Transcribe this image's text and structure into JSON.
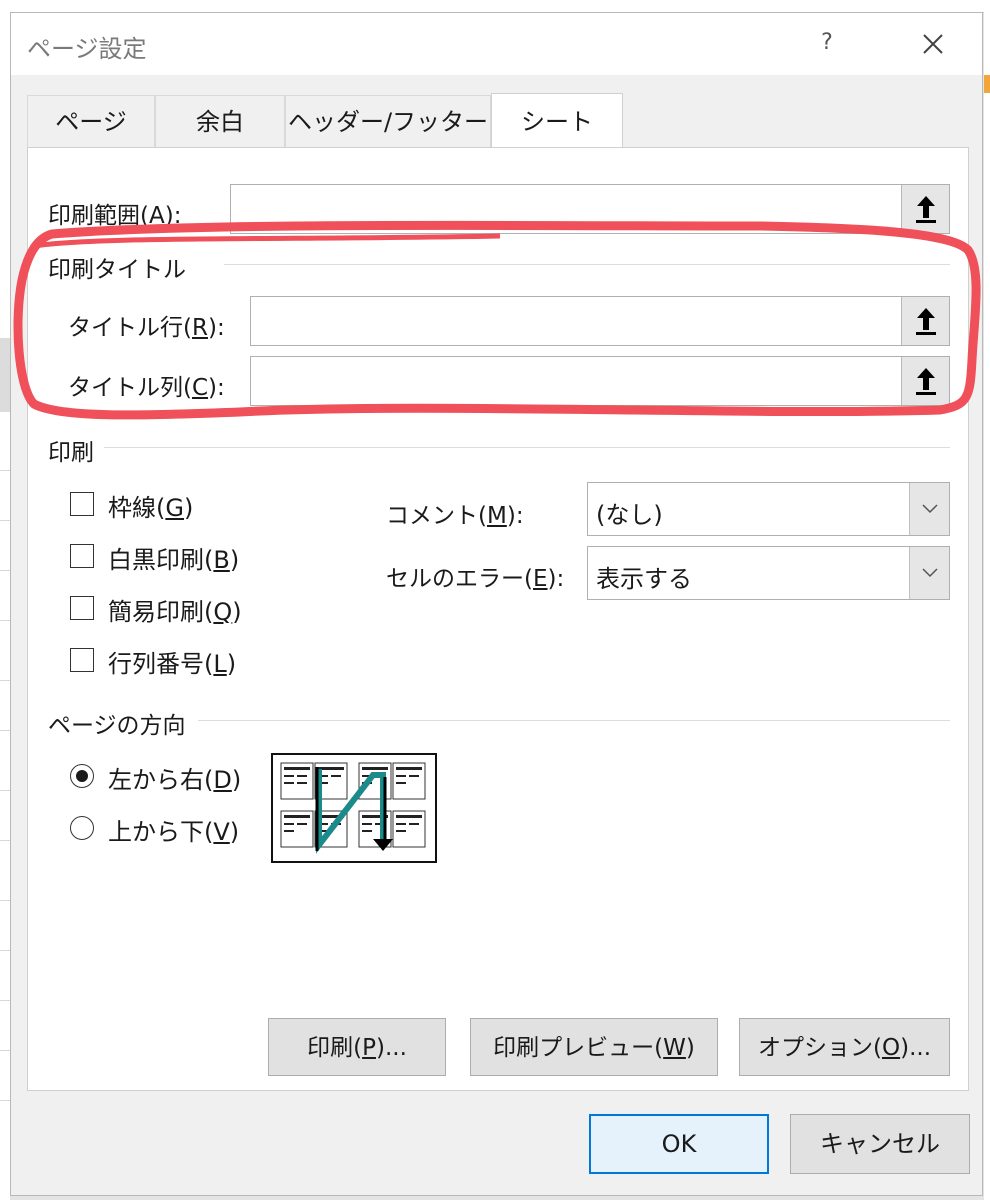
{
  "dialog": {
    "title": "ページ設定",
    "help": "?",
    "close": "✕"
  },
  "tabs": [
    {
      "label": "ページ",
      "active": false
    },
    {
      "label": "余白",
      "active": false
    },
    {
      "label": "ヘッダー/フッター",
      "active": false
    },
    {
      "label": "シート",
      "active": true
    }
  ],
  "print_area": {
    "prefix": "印刷範囲(",
    "key": "A",
    "suffix": "):",
    "value": ""
  },
  "print_titles": {
    "group_label": "印刷タイトル",
    "rows": {
      "prefix": "タイトル行(",
      "key": "R",
      "suffix": "):",
      "value": ""
    },
    "columns": {
      "prefix": "タイトル列(",
      "key": "C",
      "suffix": "):",
      "value": ""
    }
  },
  "print": {
    "group_label": "印刷",
    "checkboxes": [
      {
        "prefix": "枠線(",
        "key": "G",
        "suffix": ")",
        "checked": false
      },
      {
        "prefix": "白黒印刷(",
        "key": "B",
        "suffix": ")",
        "checked": false
      },
      {
        "prefix": "簡易印刷(",
        "key": "Q",
        "suffix": ")",
        "checked": false
      },
      {
        "prefix": "行列番号(",
        "key": "L",
        "suffix": ")",
        "checked": false
      }
    ],
    "comments": {
      "prefix": "コメント(",
      "key": "M",
      "suffix": "):",
      "value": "(なし)"
    },
    "cell_errors": {
      "prefix": "セルのエラー(",
      "key": "E",
      "suffix": "):",
      "value": "表示する"
    }
  },
  "page_order": {
    "group_label": "ページの方向",
    "options": [
      {
        "prefix": "左から右(",
        "key": "D",
        "suffix": ")",
        "checked": true
      },
      {
        "prefix": "上から下(",
        "key": "V",
        "suffix": ")",
        "checked": false
      }
    ]
  },
  "panel_buttons": {
    "print": {
      "prefix": "印刷(",
      "key": "P",
      "suffix": ")..."
    },
    "preview": {
      "prefix": "印刷プレビュー(",
      "key": "W",
      "suffix": ")"
    },
    "options": {
      "prefix": "オプション(",
      "key": "O",
      "suffix": ")..."
    }
  },
  "footer_buttons": {
    "ok": "OK",
    "cancel": "キャンセル"
  },
  "colors": {
    "highlight": "#f0505a",
    "accent": "#0078d7",
    "arrow": "#1a8a8a"
  },
  "icons": {
    "collapse": "up-arrow-icon",
    "dropdown": "chevron-down-icon"
  }
}
